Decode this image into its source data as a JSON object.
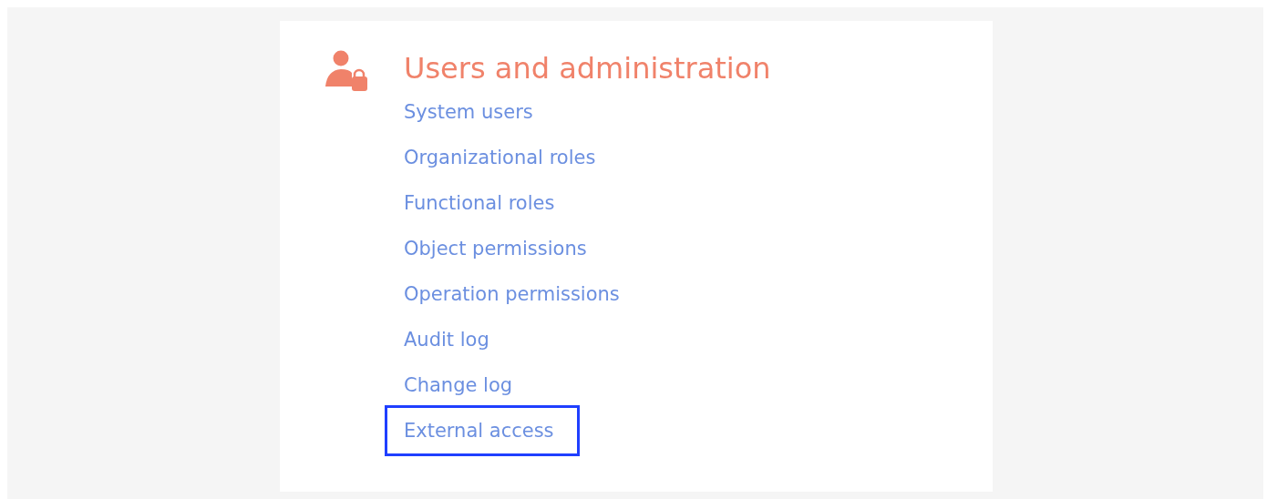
{
  "section": {
    "title": "Users and administration",
    "links": [
      {
        "label": "System users",
        "highlighted": false
      },
      {
        "label": "Organizational roles",
        "highlighted": false
      },
      {
        "label": "Functional roles",
        "highlighted": false
      },
      {
        "label": "Object permissions",
        "highlighted": false
      },
      {
        "label": "Operation permissions",
        "highlighted": false
      },
      {
        "label": "Audit log",
        "highlighted": false
      },
      {
        "label": "Change log",
        "highlighted": false
      },
      {
        "label": "External access",
        "highlighted": true
      }
    ]
  }
}
